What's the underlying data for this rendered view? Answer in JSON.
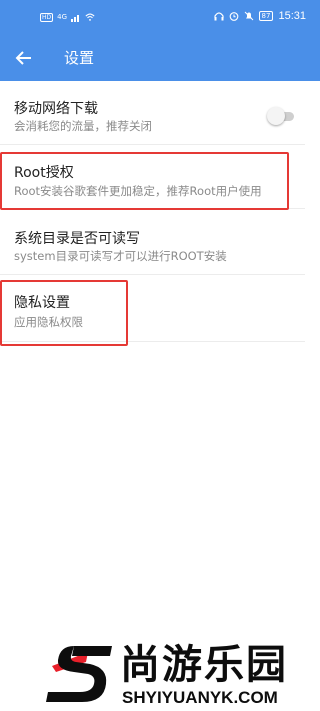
{
  "status_bar": {
    "left_tags": [
      "HD",
      "4G"
    ],
    "battery": "87",
    "time": "15:31"
  },
  "app_bar": {
    "title": "设置"
  },
  "settings": [
    {
      "title": "移动网络下载",
      "subtitle": "会消耗您的流量，推荐关闭",
      "toggle_on": false
    },
    {
      "title": "Root授权",
      "subtitle": "Root安装谷歌套件更加稳定，推荐Root用户使用"
    },
    {
      "title": "系统目录是否可读写",
      "subtitle": "system目录可读写才可以进行ROOT安装"
    },
    {
      "title": "隐私设置",
      "subtitle": "应用隐私权限"
    }
  ],
  "colors": {
    "primary": "#4a8fe8",
    "highlight": "#e53935",
    "watermark_red": "#e8202a",
    "watermark_black": "#0d0d0d"
  },
  "watermark": {
    "name": "尚游乐园",
    "url": "SHYIYUANYK.COM"
  }
}
